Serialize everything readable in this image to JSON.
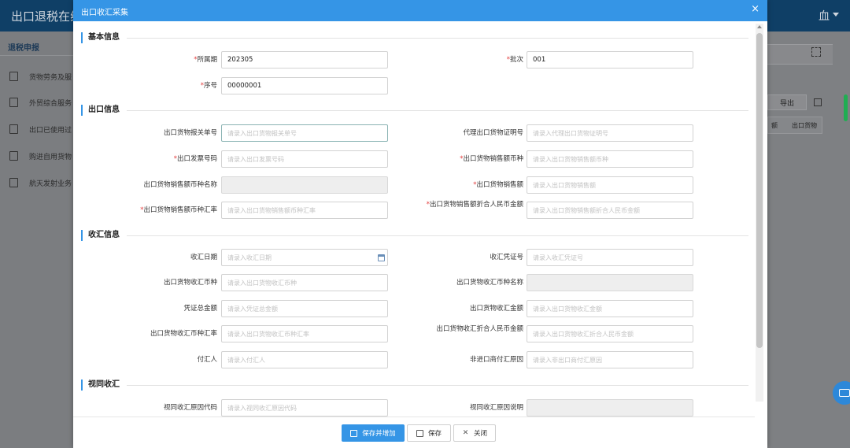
{
  "background": {
    "app_title": "出口退税在线",
    "user_glyph": "血",
    "sidebar_title": "退税申报",
    "nav_items": [
      "货物劳务及服",
      "外贸综合服务",
      "出口已使用过",
      "购进自用货物",
      "航天发射业务"
    ],
    "export_label": "导出",
    "table_cols": [
      "额",
      "出口货物"
    ]
  },
  "modal": {
    "title": "出口收汇采集",
    "close": "×",
    "sections": {
      "basic": "基本信息",
      "export": "出口信息",
      "collection": "收汇信息",
      "deemed": "视同收汇"
    },
    "fields": {
      "period": {
        "label": "所属期",
        "value": "202305",
        "required": true
      },
      "batch": {
        "label": "批次",
        "value": "001",
        "required": true
      },
      "seq": {
        "label": "序号",
        "value": "00000001",
        "required": true
      },
      "customs_no": {
        "label": "出口货物报关单号",
        "placeholder": "请录入出口货物报关单号"
      },
      "agent_cert_no": {
        "label": "代理出口货物证明号",
        "placeholder": "请录入代理出口货物证明号"
      },
      "invoice_no": {
        "label": "出口发票号码",
        "placeholder": "请录入出口发票号码",
        "required": true
      },
      "sales_currency": {
        "label": "出口货物销售额币种",
        "placeholder": "请录入出口货物销售额币种",
        "required": true
      },
      "sales_currency_name": {
        "label": "出口货物销售额币种名称",
        "placeholder": ""
      },
      "sales_amount": {
        "label": "出口货物销售额",
        "placeholder": "请录入出口货物销售额",
        "required": true
      },
      "sales_rate": {
        "label": "出口货物销售额币种汇率",
        "placeholder": "请录入出口货物销售额币种汇率",
        "required": true
      },
      "sales_rmb": {
        "label": "出口货物销售额折合人民币金额",
        "placeholder": "请录入出口货物销售额折合人民币金额",
        "required": true
      },
      "collect_date": {
        "label": "收汇日期",
        "placeholder": "请录入收汇日期"
      },
      "voucher_no": {
        "label": "收汇凭证号",
        "placeholder": "请录入收汇凭证号"
      },
      "collect_currency": {
        "label": "出口货物收汇币种",
        "placeholder": "请录入出口货物收汇币种"
      },
      "collect_currency_name": {
        "label": "出口货物收汇币种名称",
        "placeholder": ""
      },
      "voucher_total": {
        "label": "凭证总金额",
        "placeholder": "请录入凭证总金额"
      },
      "collect_amount": {
        "label": "出口货物收汇金额",
        "placeholder": "请录入出口货物收汇金额"
      },
      "collect_rate": {
        "label": "出口货物收汇币种汇率",
        "placeholder": "请录入出口货物收汇币种汇率"
      },
      "collect_rmb": {
        "label": "出口货物收汇折合人民币金额",
        "placeholder": "请录入出口货物收汇折合人民币金额"
      },
      "payer": {
        "label": "付汇人",
        "placeholder": "请录入付汇人"
      },
      "non_importer_reason": {
        "label": "非进口商付汇原因",
        "placeholder": "请录入非出口商付汇原因"
      },
      "deemed_reason_code": {
        "label": "视同收汇原因代码",
        "placeholder": "请录入视同收汇原因代码"
      },
      "deemed_reason_desc": {
        "label": "视同收汇原因说明",
        "placeholder": ""
      }
    },
    "buttons": {
      "save_add": "保存并增加",
      "save": "保存",
      "close": "关闭"
    }
  },
  "colors": {
    "accent": "#3595e6",
    "required": "#e23b3b",
    "header_bg": "#0f3f66"
  }
}
